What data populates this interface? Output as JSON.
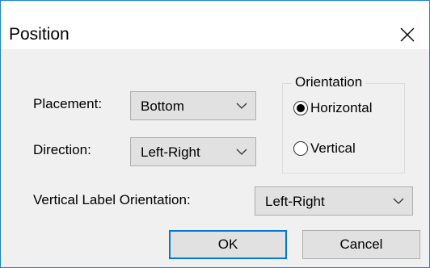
{
  "window": {
    "title": "Position"
  },
  "placement": {
    "label": "Placement:",
    "value": "Bottom"
  },
  "direction": {
    "label": "Direction:",
    "value": "Left-Right"
  },
  "vertical_label": {
    "label": "Vertical Label Orientation:",
    "value": "Left-Right"
  },
  "orientation": {
    "legend": "Orientation",
    "options": [
      {
        "label": "Horizontal",
        "selected": true
      },
      {
        "label": "Vertical",
        "selected": false
      }
    ]
  },
  "buttons": {
    "ok": "OK",
    "cancel": "Cancel"
  },
  "colors": {
    "accent": "#0078d7",
    "window_border": "#1883d7",
    "background": "#f0f0f0",
    "control_face": "#e1e1e1"
  },
  "icons": {
    "close": "close-icon",
    "dropdown": "chevron-down-icon"
  }
}
